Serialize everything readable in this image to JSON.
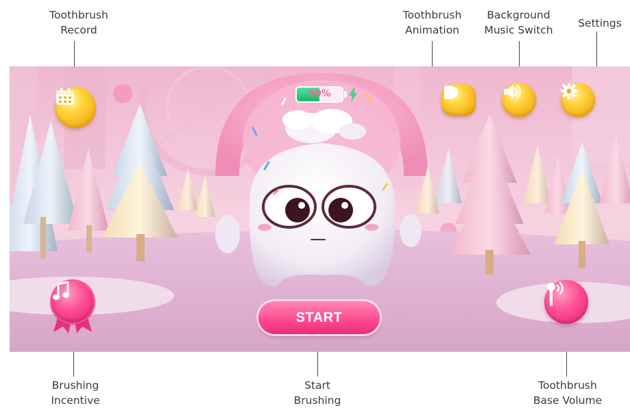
{
  "annotations": {
    "toothbrush_record": [
      "Toothbrush",
      "Record"
    ],
    "toothbrush_animation": [
      "Toothbrush",
      "Animation"
    ],
    "background_music": [
      "Background",
      "Music Switch"
    ],
    "settings": "Settings",
    "brushing_incentive": [
      "Brushing",
      "Incentive"
    ],
    "start_brushing": [
      "Start",
      "Brushing"
    ],
    "base_volume": [
      "Toothbrush",
      "Base Volume"
    ]
  },
  "hud": {
    "battery_text": "50%",
    "battery_level": 0.5
  },
  "controls": {
    "start_label": "START"
  },
  "icons": {
    "record": "calendar-icon",
    "animation": "play-bubble-icon",
    "music": "speaker-icon",
    "settings": "gear-icon",
    "incentive": "music-note-icon",
    "volume": "volume-toothbrush-icon",
    "charging": "lightning-icon"
  },
  "colors": {
    "gold_button": "#f7b51b",
    "pink_button": "#ff4d92",
    "start_button": "#ff4d91",
    "battery_fill": "#25c278",
    "sky": "#f3c2d6"
  }
}
